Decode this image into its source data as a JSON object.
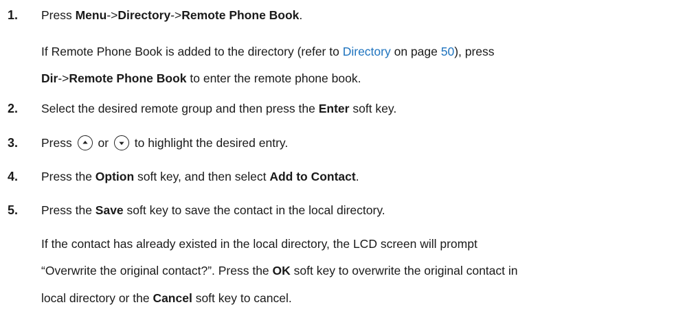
{
  "step1": {
    "number": "1.",
    "press": "Press ",
    "menu": "Menu",
    "arrow1": "->",
    "directory": "Directory",
    "arrow2": "->",
    "remote_phone_book": "Remote Phone Book",
    "period": "."
  },
  "step1_note": {
    "line1_a": "If Remote Phone Book is added to the directory (refer to ",
    "directory_link": "Directory",
    "on_page": " on page ",
    "page_link": "50",
    "line1_b": "), press",
    "dir": "Dir",
    "arrow": "->",
    "remote_phone_book": "Remote Phone Book",
    "line2_tail": " to enter the remote phone book."
  },
  "step2": {
    "number": "2.",
    "text_a": "Select the desired remote group and then press the ",
    "enter": "Enter",
    "text_b": " soft key."
  },
  "step3": {
    "number": "3.",
    "press": "Press",
    "or": "or",
    "tail": "to highlight the desired entry.",
    "up_icon": "up-arrow-key",
    "down_icon": "down-arrow-key"
  },
  "step4": {
    "number": "4.",
    "text_a": "Press the ",
    "option": "Option",
    "text_b": " soft key, and then select ",
    "add_to_contact": "Add to Contact",
    "period": "."
  },
  "step5": {
    "number": "5.",
    "text_a": "Press the ",
    "save": "Save",
    "text_b": " soft key to save the contact in the local directory."
  },
  "step5_note": {
    "line1": "If the contact has already existed in the local directory, the LCD screen will prompt",
    "line2_a": "“Overwrite the original contact?”. Press the ",
    "ok": "OK",
    "line2_b": " soft key to overwrite the original contact in",
    "line3_a": "local directory or the ",
    "cancel": "Cancel",
    "line3_b": " soft key to cancel."
  }
}
